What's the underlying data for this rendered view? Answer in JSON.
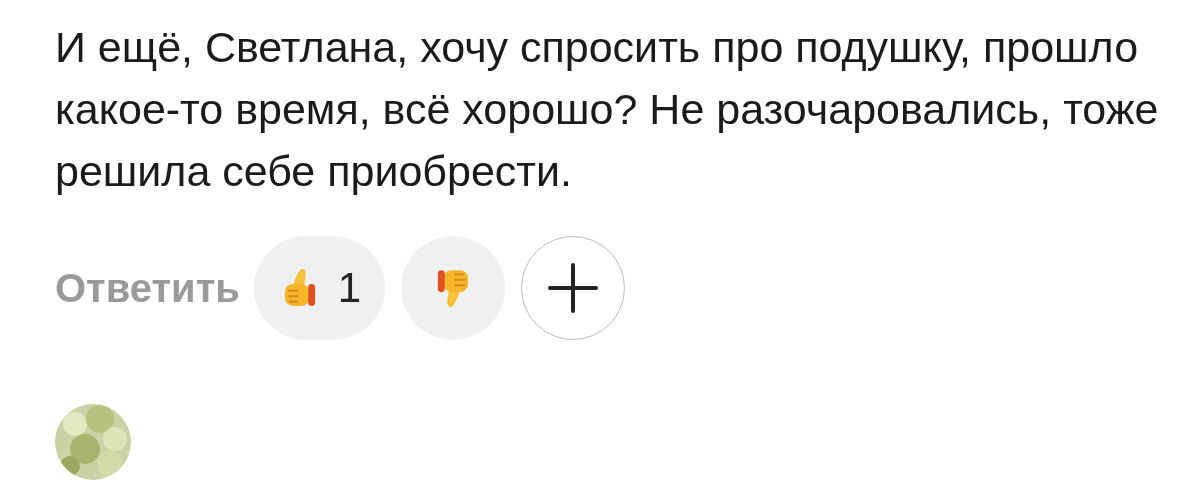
{
  "comment": {
    "text": "И ещё, Светлана, хочу спросить про подушку, прошло какое-то время, всё хорошо? Не разочаровались, тоже решила себе приобрести.",
    "reply_label": "Ответить",
    "reactions": [
      {
        "kind": "like",
        "count": "1"
      },
      {
        "kind": "dislike"
      },
      {
        "kind": "add"
      }
    ]
  }
}
